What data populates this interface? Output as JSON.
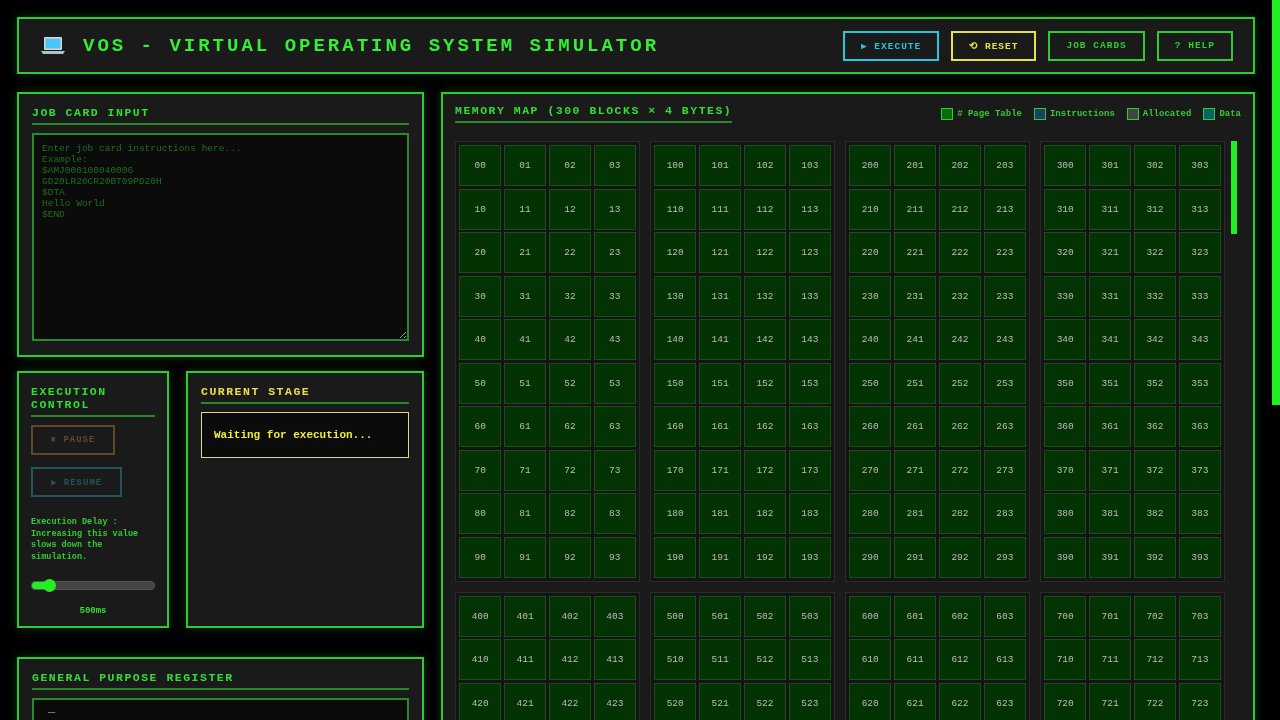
{
  "header": {
    "title": "VOS - VIRTUAL OPERATING SYSTEM SIMULATOR",
    "buttons": [
      {
        "label": "▶ EXECUTE",
        "kind": "primary"
      },
      {
        "label": "⟲ RESET",
        "kind": "warning"
      },
      {
        "label": "JOB CARDS",
        "kind": "default"
      },
      {
        "label": "? HELP",
        "kind": "default"
      }
    ]
  },
  "job_card_input": {
    "title": "JOB CARD INPUT",
    "placeholder": "Enter job card instructions here...\nExample:\n$AMJ000100040006\nGD20LR20CR20BT09PD20H\n$DTA\nHello World\n$END"
  },
  "execution_control": {
    "title": "EXECUTION CONTROL",
    "buttons": [
      {
        "label": "⏸ PAUSE",
        "kind": "pause",
        "disabled": true
      },
      {
        "label": "▶ RESUME",
        "kind": "resume",
        "disabled": true
      }
    ],
    "delay_note": "Execution Delay : Increasing this value slows down the simulation.",
    "delay_slider": {
      "level": 0.14
    },
    "delay_value": "500ms"
  },
  "current_stage": {
    "title": "CURRENT STAGE",
    "message": "Waiting for execution..."
  },
  "register": {
    "title": "GENERAL PURPOSE REGISTER",
    "value": "_"
  },
  "memory_map": {
    "title": "MEMORY MAP (300 BLOCKS × 4 BYTES)",
    "legend": [
      {
        "label": "# Page Table",
        "color": "#0b6b0b"
      },
      {
        "label": "Instructions",
        "color": "#1d3f66"
      },
      {
        "label": "Allocated",
        "color": "#444444"
      },
      {
        "label": "Data",
        "color": "#0a6464"
      }
    ],
    "blocks": [
      {
        "rows": [
          [
            "00",
            "01",
            "02",
            "03"
          ],
          [
            "10",
            "11",
            "12",
            "13"
          ],
          [
            "20",
            "21",
            "22",
            "23"
          ],
          [
            "30",
            "31",
            "32",
            "33"
          ],
          [
            "40",
            "41",
            "42",
            "43"
          ],
          [
            "50",
            "51",
            "52",
            "53"
          ],
          [
            "60",
            "61",
            "62",
            "63"
          ],
          [
            "70",
            "71",
            "72",
            "73"
          ],
          [
            "80",
            "81",
            "82",
            "83"
          ],
          [
            "90",
            "91",
            "92",
            "93"
          ]
        ]
      },
      {
        "rows": [
          [
            "100",
            "101",
            "102",
            "103"
          ],
          [
            "110",
            "111",
            "112",
            "113"
          ],
          [
            "120",
            "121",
            "122",
            "123"
          ],
          [
            "130",
            "131",
            "132",
            "133"
          ],
          [
            "140",
            "141",
            "142",
            "143"
          ],
          [
            "150",
            "151",
            "152",
            "153"
          ],
          [
            "160",
            "161",
            "162",
            "163"
          ],
          [
            "170",
            "171",
            "172",
            "173"
          ],
          [
            "180",
            "181",
            "182",
            "183"
          ],
          [
            "190",
            "191",
            "192",
            "193"
          ]
        ]
      },
      {
        "rows": [
          [
            "200",
            "201",
            "202",
            "203"
          ],
          [
            "210",
            "211",
            "212",
            "213"
          ],
          [
            "220",
            "221",
            "222",
            "223"
          ],
          [
            "230",
            "231",
            "232",
            "233"
          ],
          [
            "240",
            "241",
            "242",
            "243"
          ],
          [
            "250",
            "251",
            "252",
            "253"
          ],
          [
            "260",
            "261",
            "262",
            "263"
          ],
          [
            "270",
            "271",
            "272",
            "273"
          ],
          [
            "280",
            "281",
            "282",
            "283"
          ],
          [
            "290",
            "291",
            "292",
            "293"
          ]
        ]
      },
      {
        "rows": [
          [
            "300",
            "301",
            "302",
            "303"
          ],
          [
            "310",
            "311",
            "312",
            "313"
          ],
          [
            "320",
            "321",
            "322",
            "323"
          ],
          [
            "330",
            "331",
            "332",
            "333"
          ],
          [
            "340",
            "341",
            "342",
            "343"
          ],
          [
            "350",
            "351",
            "352",
            "353"
          ],
          [
            "360",
            "361",
            "362",
            "363"
          ],
          [
            "370",
            "371",
            "372",
            "373"
          ],
          [
            "380",
            "381",
            "382",
            "383"
          ],
          [
            "390",
            "391",
            "392",
            "393"
          ]
        ]
      },
      {
        "rows": [
          [
            "400",
            "401",
            "402",
            "403"
          ],
          [
            "410",
            "411",
            "412",
            "413"
          ],
          [
            "420",
            "421",
            "422",
            "423"
          ]
        ]
      },
      {
        "rows": [
          [
            "500",
            "501",
            "502",
            "503"
          ],
          [
            "510",
            "511",
            "512",
            "513"
          ],
          [
            "520",
            "521",
            "522",
            "523"
          ]
        ]
      },
      {
        "rows": [
          [
            "600",
            "601",
            "602",
            "603"
          ],
          [
            "610",
            "611",
            "612",
            "613"
          ],
          [
            "620",
            "621",
            "622",
            "623"
          ]
        ]
      },
      {
        "rows": [
          [
            "700",
            "701",
            "702",
            "703"
          ],
          [
            "710",
            "711",
            "712",
            "713"
          ],
          [
            "720",
            "721",
            "722",
            "723"
          ]
        ]
      }
    ]
  }
}
